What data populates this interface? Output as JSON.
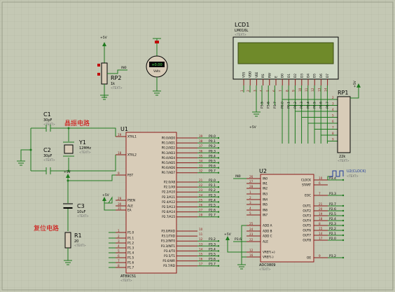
{
  "components": {
    "lcd": {
      "ref": "LCD1",
      "model": "LM016L",
      "tag": "<TEXT>",
      "pins": [
        "VSS",
        "VDD",
        "VEE",
        "RS",
        "RW",
        "E",
        "D0",
        "D1",
        "D2",
        "D3",
        "D4",
        "D5",
        "D6",
        "D7"
      ]
    },
    "rp1": {
      "ref": "RP1",
      "value": "22k",
      "tag": "<TEXT>"
    },
    "rp2": {
      "ref": "RP2",
      "value": "1k",
      "tag": "<TEXT>",
      "power": "+5V",
      "net": "IN0"
    },
    "meter": {
      "label": "Volts",
      "reading": "+0.00"
    },
    "meter_gnd": "+5V",
    "c1": {
      "ref": "C1",
      "value": "30pF",
      "tag": "<TEXT>"
    },
    "c2": {
      "ref": "C2",
      "value": "30pF",
      "tag": "<TEXT>"
    },
    "c3": {
      "ref": "C3",
      "value": "10uF",
      "tag": "<TEXT>"
    },
    "y1": {
      "ref": "Y1",
      "value": "12MHz",
      "tag": "<TEXT>"
    },
    "r1": {
      "ref": "R1",
      "value": "20",
      "tag": "<TEXT>"
    },
    "u1": {
      "ref": "U1",
      "model": "AT89C51",
      "tag": "<TEXT>",
      "left_pins": [
        [
          "19",
          "XTAL1"
        ],
        [
          "18",
          "XTAL2"
        ],
        [
          "9",
          "RST"
        ],
        [
          "29",
          "PSEN"
        ],
        [
          "30",
          "ALE"
        ],
        [
          "31",
          "EA"
        ],
        [
          "1",
          "P1.0"
        ],
        [
          "2",
          "P1.1"
        ],
        [
          "3",
          "P1.2"
        ],
        [
          "4",
          "P1.3"
        ],
        [
          "5",
          "P1.4"
        ],
        [
          "6",
          "P1.5"
        ],
        [
          "7",
          "P1.6"
        ],
        [
          "8",
          "P1.7"
        ]
      ],
      "right_pins": [
        [
          "39",
          "P0.0/AD0"
        ],
        [
          "38",
          "P0.1/AD1"
        ],
        [
          "37",
          "P0.2/AD2"
        ],
        [
          "36",
          "P0.3/AD3"
        ],
        [
          "35",
          "P0.4/AD4"
        ],
        [
          "34",
          "P0.5/AD5"
        ],
        [
          "33",
          "P0.6/AD6"
        ],
        [
          "32",
          "P0.7/AD7"
        ],
        [
          "21",
          "P2.0/A8"
        ],
        [
          "22",
          "P2.1/A9"
        ],
        [
          "23",
          "P2.2/A10"
        ],
        [
          "24",
          "P2.3/A11"
        ],
        [
          "25",
          "P2.4/A12"
        ],
        [
          "26",
          "P2.5/A13"
        ],
        [
          "27",
          "P2.6/A14"
        ],
        [
          "28",
          "P2.7/A15"
        ],
        [
          "10",
          "P3.0/RXD"
        ],
        [
          "11",
          "P3.1/TXD"
        ],
        [
          "12",
          "P3.2/INT0"
        ],
        [
          "13",
          "P3.3/INT1"
        ],
        [
          "14",
          "P3.4/T0"
        ],
        [
          "15",
          "P3.5/T1"
        ],
        [
          "16",
          "P3.6/WR"
        ],
        [
          "17",
          "P3.7/RD"
        ]
      ],
      "right_nets": [
        "P0.0",
        "P0.1",
        "P0.2",
        "P0.3",
        "P0.4",
        "P0.5",
        "P0.6",
        "P0.7",
        "P2.0",
        "P2.1",
        "P2.2",
        "P2.3",
        "P2.4",
        "P2.5",
        "P2.6",
        "P2.7",
        "",
        "",
        "P3.2",
        "P3.3",
        "P3.4",
        "P3.5",
        "P3.6",
        "P3.7"
      ]
    },
    "u2": {
      "ref": "U2",
      "model": "ADC0809",
      "tag": "<TEXT>",
      "left_pins": [
        [
          "26",
          "IN0"
        ],
        [
          "27",
          "IN1"
        ],
        [
          "28",
          "IN2"
        ],
        [
          "1",
          "IN3"
        ],
        [
          "2",
          "IN4"
        ],
        [
          "3",
          "IN5"
        ],
        [
          "4",
          "IN6"
        ],
        [
          "5",
          "IN7"
        ],
        [
          "25",
          "ADD A"
        ],
        [
          "24",
          "ADD B"
        ],
        [
          "23",
          "ADD C"
        ],
        [
          "22",
          "ALE"
        ],
        [
          "12",
          "VREF(+)"
        ],
        [
          "16",
          "VREF(-)"
        ]
      ],
      "right_pins": [
        [
          "10",
          "CLOCK"
        ],
        [
          "6",
          "START"
        ],
        [
          "7",
          "EOC"
        ],
        [
          "21",
          "OUT1"
        ],
        [
          "20",
          "OUT2"
        ],
        [
          "19",
          "OUT3"
        ],
        [
          "18",
          "OUT4"
        ],
        [
          "8",
          "OUT5"
        ],
        [
          "15",
          "OUT6"
        ],
        [
          "14",
          "OUT7"
        ],
        [
          "17",
          "OUT8"
        ],
        [
          "9",
          "OE"
        ]
      ],
      "right_nets": [
        "P3.4",
        "",
        "P3.3",
        "P2.7",
        "P2.6",
        "P2.5",
        "P2.4",
        "P2.3",
        "P2.2",
        "P2.1",
        "P2.0",
        "P3.2"
      ],
      "in0_net": "IN0",
      "vref_net": "+5V",
      "add_net": "P3.6"
    },
    "clock": {
      "label": "U2(CLOCK)",
      "tag": "<TEXT>"
    },
    "lcd_nets": [
      "P3.5",
      "P3.6",
      "P3.7"
    ],
    "lcd_power": "+5V",
    "lcd_data_nets": [
      "P0.0",
      "P0.1",
      "P0.2",
      "P0.3",
      "P0.4",
      "P0.5",
      "P0.6",
      "P0.7"
    ],
    "rp1_power": "+5V",
    "reset_power": "+5V",
    "ea_power": "+5V"
  },
  "captions": {
    "oscillator": "晶振电路",
    "reset": "复位电路"
  },
  "colors": {
    "background": "#c4c8b4",
    "wire": "#1f7a1f",
    "body": "#d8ccb8",
    "caption": "#d00000"
  }
}
